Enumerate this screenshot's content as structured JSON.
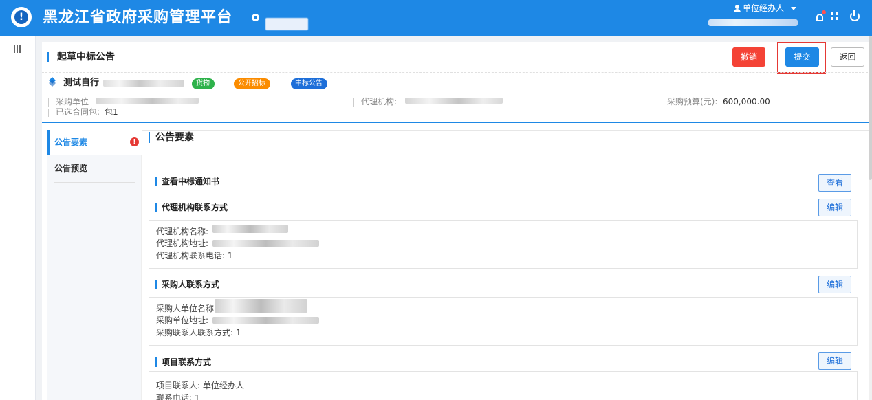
{
  "header": {
    "app_title": "黑龙江省政府采购管理平台",
    "user_role": "单位经办人"
  },
  "page": {
    "title": "起草中标公告",
    "buttons": {
      "cancel": "撤销",
      "submit": "提交",
      "back": "返回"
    }
  },
  "project": {
    "name_prefix": "测试自行",
    "tags": [
      "货物",
      "公开招标",
      "中标公告"
    ],
    "purchase_unit_label": "采购单位",
    "agency_label": "代理机构:",
    "budget_label": "采购预算(元):",
    "budget_value": "600,000.00",
    "selected_contract_label": "已选合同包:",
    "selected_contract_value": "包1"
  },
  "side_nav": {
    "items": [
      "公告要素",
      "公告预览"
    ]
  },
  "form": {
    "title": "公告要素",
    "sections": {
      "notice": {
        "title": "查看中标通知书",
        "button": "查看"
      },
      "agency": {
        "title": "代理机构联系方式",
        "button": "编辑",
        "lines": [
          "代理机构名称:",
          "代理机构地址:",
          "代理机构联系电话:  1"
        ]
      },
      "purchaser": {
        "title": "采购人联系方式",
        "button": "编辑",
        "lines": [
          "采购人单位名称:",
          "采购单位地址:",
          "采购联系人联系方式:  1"
        ]
      },
      "project": {
        "title": "项目联系方式",
        "button": "编辑",
        "lines": [
          "项目联系人:  单位经办人",
          "联系电话:  1"
        ]
      }
    }
  },
  "colors": {
    "brand": "#1e88e5",
    "danger": "#f44336",
    "tag_goods": "#2eb24b",
    "tag_open": "#fb8c00",
    "tag_award": "#1e6fd9"
  },
  "icons": [
    "logo-icon",
    "location-icon",
    "user-icon",
    "bell-icon",
    "expand-icon",
    "power-icon",
    "menu-icon",
    "layers-icon",
    "alert-icon"
  ]
}
